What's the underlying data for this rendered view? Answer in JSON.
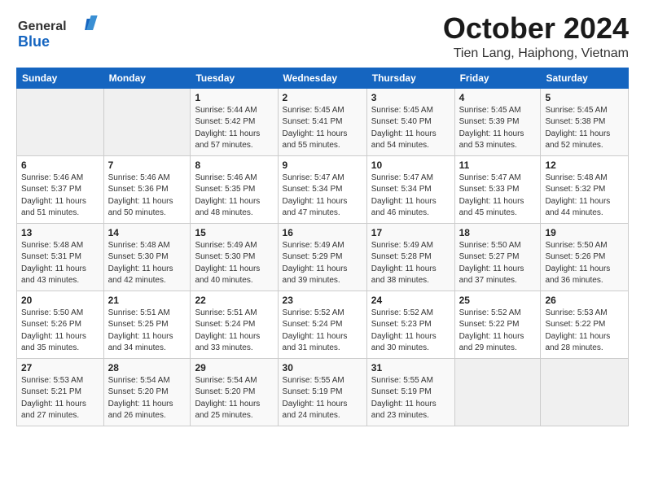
{
  "header": {
    "logo_general": "General",
    "logo_blue": "Blue",
    "month_title": "October 2024",
    "location": "Tien Lang, Haiphong, Vietnam"
  },
  "days_of_week": [
    "Sunday",
    "Monday",
    "Tuesday",
    "Wednesday",
    "Thursday",
    "Friday",
    "Saturday"
  ],
  "weeks": [
    [
      {
        "day": "",
        "sunrise": "",
        "sunset": "",
        "daylight": ""
      },
      {
        "day": "",
        "sunrise": "",
        "sunset": "",
        "daylight": ""
      },
      {
        "day": "1",
        "sunrise": "Sunrise: 5:44 AM",
        "sunset": "Sunset: 5:42 PM",
        "daylight": "Daylight: 11 hours and 57 minutes."
      },
      {
        "day": "2",
        "sunrise": "Sunrise: 5:45 AM",
        "sunset": "Sunset: 5:41 PM",
        "daylight": "Daylight: 11 hours and 55 minutes."
      },
      {
        "day": "3",
        "sunrise": "Sunrise: 5:45 AM",
        "sunset": "Sunset: 5:40 PM",
        "daylight": "Daylight: 11 hours and 54 minutes."
      },
      {
        "day": "4",
        "sunrise": "Sunrise: 5:45 AM",
        "sunset": "Sunset: 5:39 PM",
        "daylight": "Daylight: 11 hours and 53 minutes."
      },
      {
        "day": "5",
        "sunrise": "Sunrise: 5:45 AM",
        "sunset": "Sunset: 5:38 PM",
        "daylight": "Daylight: 11 hours and 52 minutes."
      }
    ],
    [
      {
        "day": "6",
        "sunrise": "Sunrise: 5:46 AM",
        "sunset": "Sunset: 5:37 PM",
        "daylight": "Daylight: 11 hours and 51 minutes."
      },
      {
        "day": "7",
        "sunrise": "Sunrise: 5:46 AM",
        "sunset": "Sunset: 5:36 PM",
        "daylight": "Daylight: 11 hours and 50 minutes."
      },
      {
        "day": "8",
        "sunrise": "Sunrise: 5:46 AM",
        "sunset": "Sunset: 5:35 PM",
        "daylight": "Daylight: 11 hours and 48 minutes."
      },
      {
        "day": "9",
        "sunrise": "Sunrise: 5:47 AM",
        "sunset": "Sunset: 5:34 PM",
        "daylight": "Daylight: 11 hours and 47 minutes."
      },
      {
        "day": "10",
        "sunrise": "Sunrise: 5:47 AM",
        "sunset": "Sunset: 5:34 PM",
        "daylight": "Daylight: 11 hours and 46 minutes."
      },
      {
        "day": "11",
        "sunrise": "Sunrise: 5:47 AM",
        "sunset": "Sunset: 5:33 PM",
        "daylight": "Daylight: 11 hours and 45 minutes."
      },
      {
        "day": "12",
        "sunrise": "Sunrise: 5:48 AM",
        "sunset": "Sunset: 5:32 PM",
        "daylight": "Daylight: 11 hours and 44 minutes."
      }
    ],
    [
      {
        "day": "13",
        "sunrise": "Sunrise: 5:48 AM",
        "sunset": "Sunset: 5:31 PM",
        "daylight": "Daylight: 11 hours and 43 minutes."
      },
      {
        "day": "14",
        "sunrise": "Sunrise: 5:48 AM",
        "sunset": "Sunset: 5:30 PM",
        "daylight": "Daylight: 11 hours and 42 minutes."
      },
      {
        "day": "15",
        "sunrise": "Sunrise: 5:49 AM",
        "sunset": "Sunset: 5:30 PM",
        "daylight": "Daylight: 11 hours and 40 minutes."
      },
      {
        "day": "16",
        "sunrise": "Sunrise: 5:49 AM",
        "sunset": "Sunset: 5:29 PM",
        "daylight": "Daylight: 11 hours and 39 minutes."
      },
      {
        "day": "17",
        "sunrise": "Sunrise: 5:49 AM",
        "sunset": "Sunset: 5:28 PM",
        "daylight": "Daylight: 11 hours and 38 minutes."
      },
      {
        "day": "18",
        "sunrise": "Sunrise: 5:50 AM",
        "sunset": "Sunset: 5:27 PM",
        "daylight": "Daylight: 11 hours and 37 minutes."
      },
      {
        "day": "19",
        "sunrise": "Sunrise: 5:50 AM",
        "sunset": "Sunset: 5:26 PM",
        "daylight": "Daylight: 11 hours and 36 minutes."
      }
    ],
    [
      {
        "day": "20",
        "sunrise": "Sunrise: 5:50 AM",
        "sunset": "Sunset: 5:26 PM",
        "daylight": "Daylight: 11 hours and 35 minutes."
      },
      {
        "day": "21",
        "sunrise": "Sunrise: 5:51 AM",
        "sunset": "Sunset: 5:25 PM",
        "daylight": "Daylight: 11 hours and 34 minutes."
      },
      {
        "day": "22",
        "sunrise": "Sunrise: 5:51 AM",
        "sunset": "Sunset: 5:24 PM",
        "daylight": "Daylight: 11 hours and 33 minutes."
      },
      {
        "day": "23",
        "sunrise": "Sunrise: 5:52 AM",
        "sunset": "Sunset: 5:24 PM",
        "daylight": "Daylight: 11 hours and 31 minutes."
      },
      {
        "day": "24",
        "sunrise": "Sunrise: 5:52 AM",
        "sunset": "Sunset: 5:23 PM",
        "daylight": "Daylight: 11 hours and 30 minutes."
      },
      {
        "day": "25",
        "sunrise": "Sunrise: 5:52 AM",
        "sunset": "Sunset: 5:22 PM",
        "daylight": "Daylight: 11 hours and 29 minutes."
      },
      {
        "day": "26",
        "sunrise": "Sunrise: 5:53 AM",
        "sunset": "Sunset: 5:22 PM",
        "daylight": "Daylight: 11 hours and 28 minutes."
      }
    ],
    [
      {
        "day": "27",
        "sunrise": "Sunrise: 5:53 AM",
        "sunset": "Sunset: 5:21 PM",
        "daylight": "Daylight: 11 hours and 27 minutes."
      },
      {
        "day": "28",
        "sunrise": "Sunrise: 5:54 AM",
        "sunset": "Sunset: 5:20 PM",
        "daylight": "Daylight: 11 hours and 26 minutes."
      },
      {
        "day": "29",
        "sunrise": "Sunrise: 5:54 AM",
        "sunset": "Sunset: 5:20 PM",
        "daylight": "Daylight: 11 hours and 25 minutes."
      },
      {
        "day": "30",
        "sunrise": "Sunrise: 5:55 AM",
        "sunset": "Sunset: 5:19 PM",
        "daylight": "Daylight: 11 hours and 24 minutes."
      },
      {
        "day": "31",
        "sunrise": "Sunrise: 5:55 AM",
        "sunset": "Sunset: 5:19 PM",
        "daylight": "Daylight: 11 hours and 23 minutes."
      },
      {
        "day": "",
        "sunrise": "",
        "sunset": "",
        "daylight": ""
      },
      {
        "day": "",
        "sunrise": "",
        "sunset": "",
        "daylight": ""
      }
    ]
  ]
}
